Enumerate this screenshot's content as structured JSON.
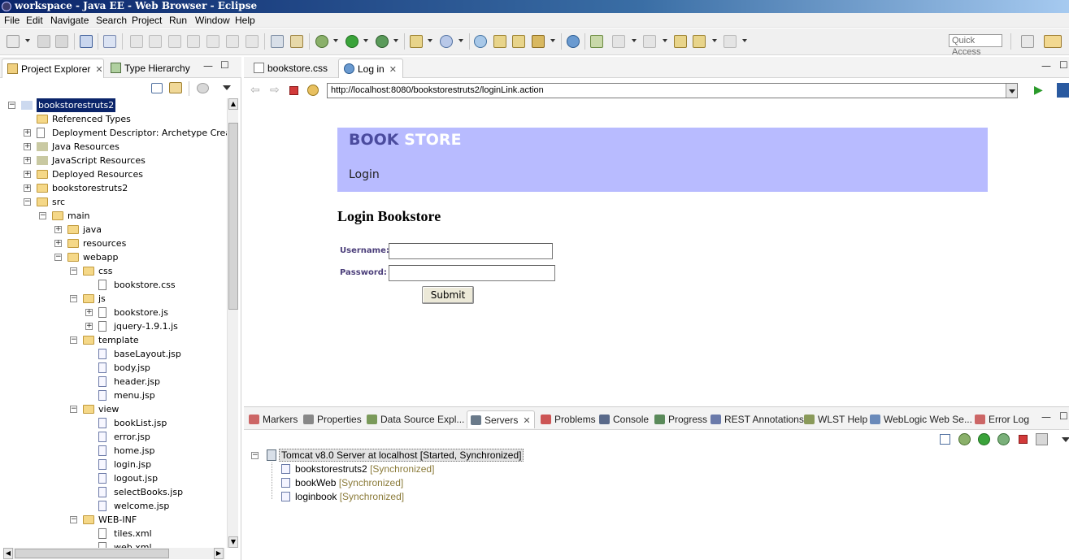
{
  "window": {
    "title": "workspace - Java EE - Web Browser - Eclipse"
  },
  "menu": [
    "File",
    "Edit",
    "Navigate",
    "Search",
    "Project",
    "Run",
    "Window",
    "Help"
  ],
  "toolbar": {
    "quick_access": "Quick Access"
  },
  "left_panel": {
    "tabs": [
      {
        "label": "Project Explorer",
        "icon": "folder-tree-icon"
      },
      {
        "label": "Type Hierarchy",
        "icon": "hierarchy-icon"
      }
    ],
    "tree": [
      {
        "label": "bookstorestruts2",
        "depth": 0,
        "expander": "minus",
        "icon": "project",
        "selected": true
      },
      {
        "label": "Referenced Types",
        "depth": 1,
        "expander": "none",
        "icon": "folder"
      },
      {
        "label": "Deployment Descriptor: Archetype Created",
        "depth": 1,
        "expander": "plus",
        "icon": "descriptor"
      },
      {
        "label": "Java Resources",
        "depth": 1,
        "expander": "plus",
        "icon": "library"
      },
      {
        "label": "JavaScript Resources",
        "depth": 1,
        "expander": "plus",
        "icon": "library"
      },
      {
        "label": "Deployed Resources",
        "depth": 1,
        "expander": "plus",
        "icon": "folder"
      },
      {
        "label": "bookstorestruts2",
        "depth": 1,
        "expander": "plus",
        "icon": "folder"
      },
      {
        "label": "src",
        "depth": 1,
        "expander": "minus",
        "icon": "folder"
      },
      {
        "label": "main",
        "depth": 2,
        "expander": "minus",
        "icon": "folder"
      },
      {
        "label": "java",
        "depth": 3,
        "expander": "plus",
        "icon": "folder"
      },
      {
        "label": "resources",
        "depth": 3,
        "expander": "plus",
        "icon": "folder"
      },
      {
        "label": "webapp",
        "depth": 3,
        "expander": "minus",
        "icon": "folder"
      },
      {
        "label": "css",
        "depth": 4,
        "expander": "minus",
        "icon": "folder"
      },
      {
        "label": "bookstore.css",
        "depth": 5,
        "expander": "none",
        "icon": "file"
      },
      {
        "label": "js",
        "depth": 4,
        "expander": "minus",
        "icon": "folder"
      },
      {
        "label": "bookstore.js",
        "depth": 5,
        "expander": "plus",
        "icon": "file"
      },
      {
        "label": "jquery-1.9.1.js",
        "depth": 5,
        "expander": "plus",
        "icon": "file"
      },
      {
        "label": "template",
        "depth": 4,
        "expander": "minus",
        "icon": "folder"
      },
      {
        "label": "baseLayout.jsp",
        "depth": 5,
        "expander": "none",
        "icon": "jsp"
      },
      {
        "label": "body.jsp",
        "depth": 5,
        "expander": "none",
        "icon": "jsp"
      },
      {
        "label": "header.jsp",
        "depth": 5,
        "expander": "none",
        "icon": "jsp"
      },
      {
        "label": "menu.jsp",
        "depth": 5,
        "expander": "none",
        "icon": "jsp"
      },
      {
        "label": "view",
        "depth": 4,
        "expander": "minus",
        "icon": "folder"
      },
      {
        "label": "bookList.jsp",
        "depth": 5,
        "expander": "none",
        "icon": "jsp"
      },
      {
        "label": "error.jsp",
        "depth": 5,
        "expander": "none",
        "icon": "jsp"
      },
      {
        "label": "home.jsp",
        "depth": 5,
        "expander": "none",
        "icon": "jsp"
      },
      {
        "label": "login.jsp",
        "depth": 5,
        "expander": "none",
        "icon": "jsp"
      },
      {
        "label": "logout.jsp",
        "depth": 5,
        "expander": "none",
        "icon": "jsp"
      },
      {
        "label": "selectBooks.jsp",
        "depth": 5,
        "expander": "none",
        "icon": "jsp"
      },
      {
        "label": "welcome.jsp",
        "depth": 5,
        "expander": "none",
        "icon": "jsp"
      },
      {
        "label": "WEB-INF",
        "depth": 4,
        "expander": "minus",
        "icon": "folder"
      },
      {
        "label": "tiles.xml",
        "depth": 5,
        "expander": "none",
        "icon": "xml"
      },
      {
        "label": "web.xml",
        "depth": 5,
        "expander": "none",
        "icon": "xml"
      }
    ]
  },
  "editor": {
    "tabs": [
      {
        "label": "bookstore.css",
        "icon": "css-file-icon",
        "active": false
      },
      {
        "label": "Log in",
        "icon": "globe-icon",
        "active": true
      }
    ],
    "url": "http://localhost:8080/bookstorestruts2/loginLink.action"
  },
  "webpage": {
    "brand_book": "BOOK",
    "brand_store": "STORE",
    "menu_login": "Login",
    "heading": "Login Bookstore",
    "username_label": "Username:",
    "password_label": "Password:",
    "username_value": "",
    "password_value": "",
    "submit_label": "Submit",
    "header_color": "#b8bbff"
  },
  "bottom_panel": {
    "tabs": [
      {
        "label": "Markers",
        "color": "#c66"
      },
      {
        "label": "Properties",
        "color": "#888"
      },
      {
        "label": "Data Source Expl...",
        "color": "#7a9a5a"
      },
      {
        "label": "Servers",
        "color": "#6a7a8a",
        "active": true
      },
      {
        "label": "Problems",
        "color": "#c55"
      },
      {
        "label": "Console",
        "color": "#5a6a8a"
      },
      {
        "label": "Progress",
        "color": "#5a8a5a"
      },
      {
        "label": "REST Annotations",
        "color": "#6a7aaa"
      },
      {
        "label": "WLST Help",
        "color": "#8a9a5a"
      },
      {
        "label": "WebLogic Web Se...",
        "color": "#6a8aba"
      },
      {
        "label": "Error Log",
        "color": "#c66"
      }
    ],
    "servers": {
      "root": "Tomcat v8.0 Server at localhost  [Started, Synchronized]",
      "modules": [
        {
          "name": "bookstorestruts2",
          "status": "[Synchronized]"
        },
        {
          "name": "bookWeb",
          "status": "[Synchronized]"
        },
        {
          "name": "loginbook",
          "status": "[Synchronized]"
        }
      ]
    }
  }
}
